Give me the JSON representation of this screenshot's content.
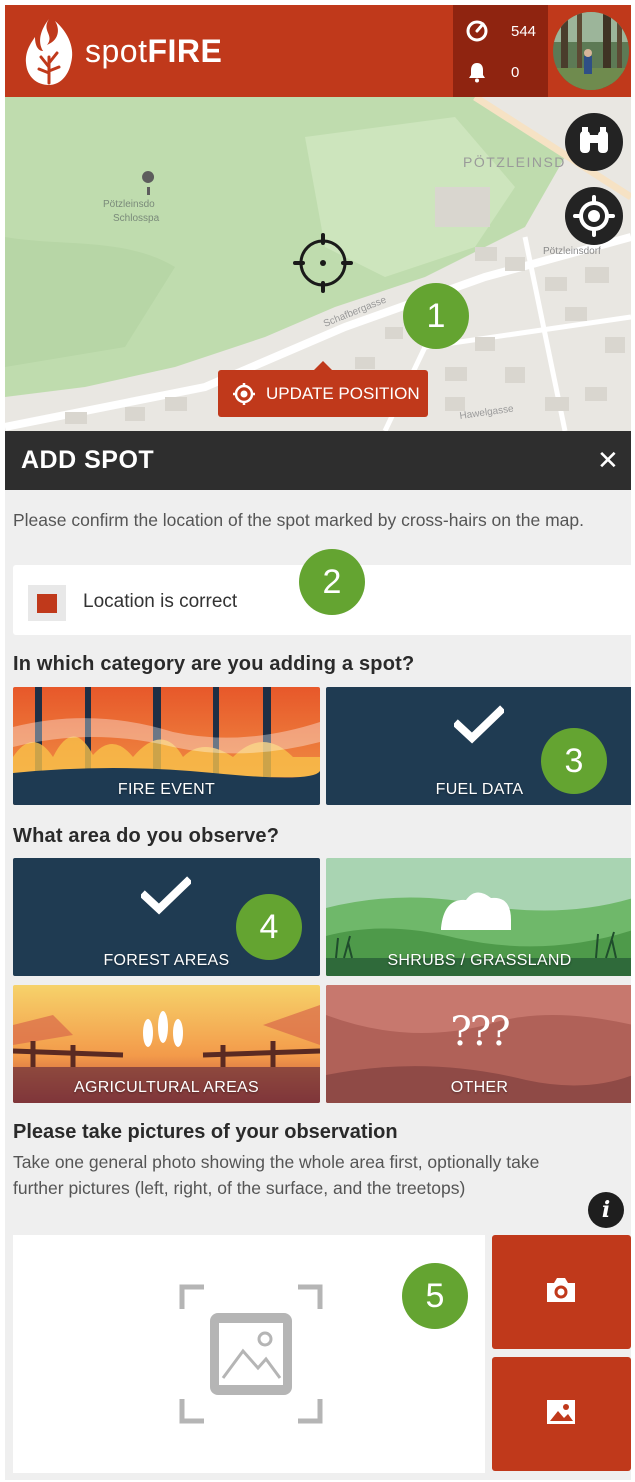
{
  "header": {
    "brand_light": "spot",
    "brand_bold": "FIRE",
    "points_count": "544",
    "notifications_count": "0"
  },
  "map": {
    "place_label_1": "Pötzleinsdo",
    "place_label_2": "Schlosspa",
    "district_label": "PÖTZLEINSD",
    "place_label_3": "Pötzleinsdorf",
    "street_label_1": "Schafbergasse",
    "street_label_2": "Hawelgasse",
    "update_position_label": "UPDATE POSITION"
  },
  "annotations": [
    "1",
    "2",
    "3",
    "4",
    "5"
  ],
  "panel": {
    "title": "ADD SPOT",
    "close_label": "✕",
    "instruction": "Please confirm the location of the spot marked by cross-hairs on the map.",
    "location_checkbox_label": "Location is correct",
    "location_checked": true,
    "category_question": "In which category are you adding a spot?",
    "categories": [
      {
        "label": "FIRE EVENT",
        "selected": false
      },
      {
        "label": "FUEL DATA",
        "selected": true
      }
    ],
    "area_question": "What area do you observe?",
    "areas": [
      {
        "label": "FOREST AREAS",
        "selected": true
      },
      {
        "label": "SHRUBS / GRASSLAND",
        "selected": false
      },
      {
        "label": "AGRICULTURAL AREAS",
        "selected": false
      },
      {
        "label": "OTHER",
        "selected": false,
        "glyph": "???"
      }
    ],
    "pictures_title": "Please take pictures of your observation",
    "pictures_text": "Take one general photo showing the whole area first, optionally take further pictures (left, right, of the surface, and the treetops)",
    "info_label": "i"
  },
  "colors": {
    "brand_red": "#c0391b",
    "dark_red": "#8f2410",
    "selected_navy": "#1f3b52",
    "badge_green": "#64a431",
    "panel_bar": "#2e2e2e"
  },
  "icons": [
    "flame-logo-icon",
    "target-points-icon",
    "bell-icon",
    "binoculars-icon",
    "gps-locate-icon",
    "crosshair-icon",
    "close-icon",
    "checkmark-icon",
    "image-placeholder-icon",
    "camera-icon",
    "gallery-icon",
    "info-icon"
  ]
}
